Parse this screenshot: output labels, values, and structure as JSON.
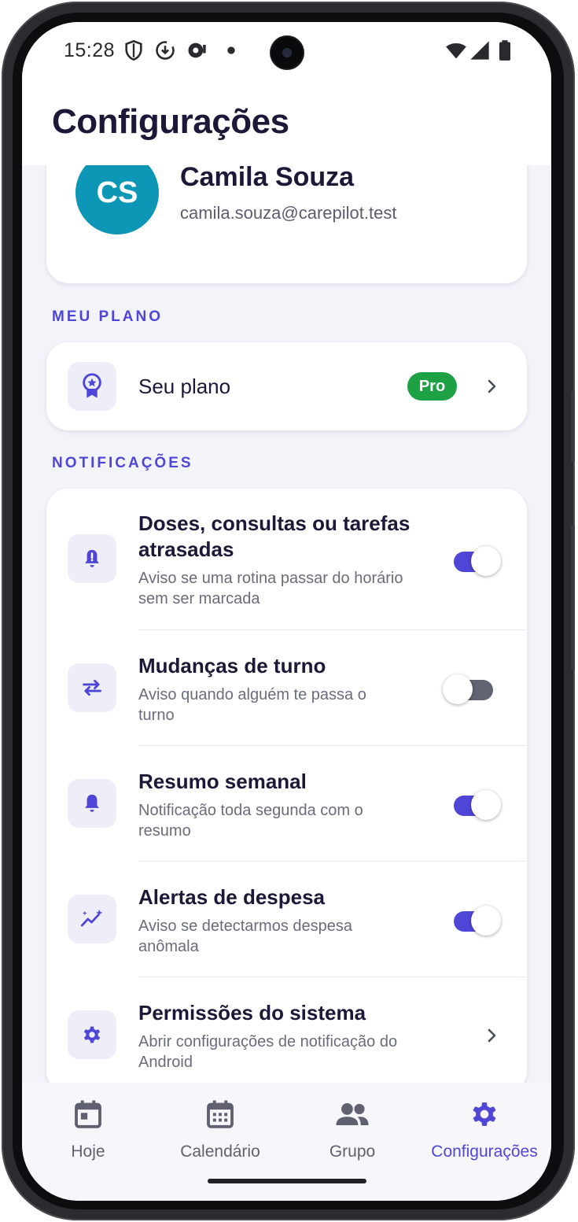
{
  "status_bar": {
    "time": "15:28"
  },
  "header": {
    "title": "Configurações"
  },
  "profile": {
    "initials": "CS",
    "name": "Camila Souza",
    "email": "camila.souza@carepilot.test",
    "avatar_color": "#0e96b6"
  },
  "plan_section": {
    "label": "MEU PLANO",
    "item": {
      "title": "Seu plano",
      "badge": "Pro",
      "icon": "award-ribbon-icon"
    }
  },
  "notifications_section": {
    "label": "NOTIFICAÇÕES",
    "items": [
      {
        "title": "Doses, consultas ou tarefas atrasadas",
        "subtitle": "Aviso se uma rotina passar do horário sem ser marcada",
        "icon": "bell-alert-icon",
        "toggle": true
      },
      {
        "title": "Mudanças de turno",
        "subtitle": "Aviso quando alguém te passa o turno",
        "icon": "swap-arrows-icon",
        "toggle": false
      },
      {
        "title": "Resumo semanal",
        "subtitle": "Notificação toda segunda com o resumo",
        "icon": "bell-icon",
        "toggle": true
      },
      {
        "title": "Alertas de despesa",
        "subtitle": "Aviso se detectarmos despesa anômala",
        "icon": "trend-sparkle-icon",
        "toggle": true
      },
      {
        "title": "Permissões do sistema",
        "subtitle": "Abrir configurações de notificação do Android",
        "icon": "gear-icon",
        "toggle": null
      }
    ]
  },
  "bottom_nav": {
    "items": [
      {
        "label": "Hoje",
        "icon": "calendar-today-icon",
        "active": false
      },
      {
        "label": "Calendário",
        "icon": "calendar-month-icon",
        "active": false
      },
      {
        "label": "Grupo",
        "icon": "group-icon",
        "active": false
      },
      {
        "label": "Configurações",
        "icon": "gear-icon",
        "active": true
      }
    ]
  },
  "colors": {
    "accent": "#4f46d8",
    "pro_badge": "#1ea044",
    "title_text": "#1c1838"
  }
}
